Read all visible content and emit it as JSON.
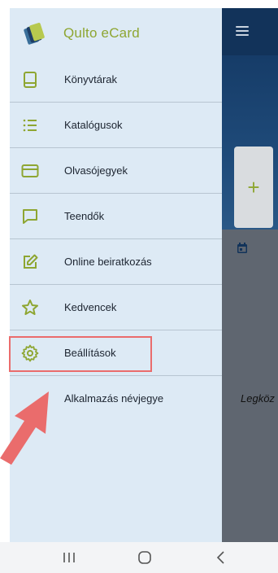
{
  "app": {
    "name": "Qulto eCard",
    "background_text": "Legköz"
  },
  "drawer": {
    "items": [
      {
        "label": "Könyvtárak",
        "icon": "book-icon"
      },
      {
        "label": "Katalógusok",
        "icon": "list-icon"
      },
      {
        "label": "Olvasójegyek",
        "icon": "card-icon"
      },
      {
        "label": "Teendők",
        "icon": "chat-icon"
      },
      {
        "label": "Online beiratkozás",
        "icon": "edit-icon"
      },
      {
        "label": "Kedvencek",
        "icon": "star-icon"
      },
      {
        "label": "Beállítások",
        "icon": "gear-icon"
      },
      {
        "label": "Alkalmazás névjegye",
        "icon": "none"
      }
    ]
  },
  "add_button": {
    "label": "+"
  },
  "colors": {
    "accent": "#8ea632",
    "drawer_bg": "#ddeaf5",
    "topbar": "#12335a",
    "highlight": "#ea6c6c"
  }
}
